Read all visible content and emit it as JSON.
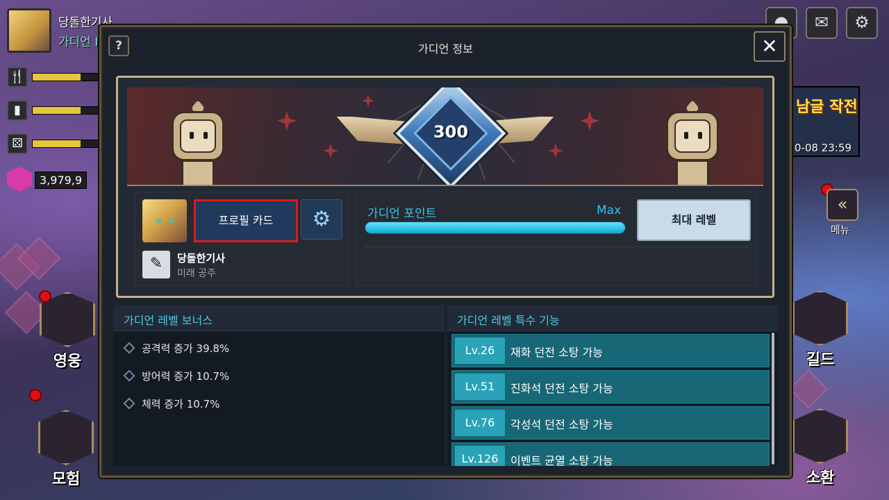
{
  "hud": {
    "player_name": "당돌한기사",
    "player_title": "가디언 I",
    "gem_count": "3,979,9",
    "resource_icons": [
      "fork-knife-icon",
      "cup-icon",
      "dice-icon"
    ]
  },
  "side_menu": {
    "hero": "영웅",
    "adventure": "모험",
    "guild": "길드",
    "summon": "소환",
    "menu": "메뉴",
    "menu_glyph": "«"
  },
  "event": {
    "title": "남글 작전",
    "time": "0-08 23:59"
  },
  "modal": {
    "title": "가디언 정보",
    "help_glyph": "?",
    "close_glyph": "✕"
  },
  "banner": {
    "level": "300"
  },
  "profile": {
    "card_button": "프로필 카드",
    "settings_glyph": "⚙",
    "edit_glyph": "✎",
    "nickname": "당돌한기사",
    "title": "미래 공주"
  },
  "points": {
    "label": "가디언 포인트",
    "max_label": "Max",
    "progress": 1.0,
    "max_level_button": "최대 레벨"
  },
  "bonus": {
    "header": "가디언 레벨 보너스",
    "items": [
      "공격력 증가 39.8%",
      "방어력 증가 10.7%",
      "체력 증가 10.7%"
    ]
  },
  "special": {
    "header": "가디언 레벨 특수 기능",
    "rows": [
      {
        "level": "Lv.26",
        "text": "재화 던전 소탕 가능"
      },
      {
        "level": "Lv.51",
        "text": "진화석 던전 소탕 가능"
      },
      {
        "level": "Lv.76",
        "text": "각성석 던전 소탕 가능"
      },
      {
        "level": "Lv.126",
        "text": "이벤트 균열 소탕 가능"
      }
    ]
  },
  "colors": {
    "accent": "#34c7e6",
    "highlight": "#e01a1a",
    "row_bg": "#176776"
  }
}
